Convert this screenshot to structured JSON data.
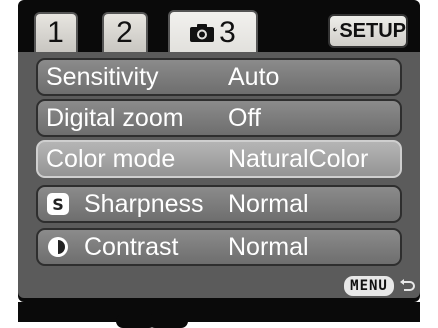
{
  "tabs": [
    {
      "label": "1",
      "active": false
    },
    {
      "label": "2",
      "active": false
    },
    {
      "label": "3",
      "icon": "camera-icon",
      "active": true
    }
  ],
  "setup": {
    "label": "SETUP",
    "icon": "wrench-icon"
  },
  "menu_items": [
    {
      "label": "Sensitivity",
      "value": "Auto",
      "selected": false
    },
    {
      "label": "Digital zoom",
      "value": "Off",
      "selected": false
    },
    {
      "label": "Color mode",
      "value": "NaturalColor",
      "selected": true
    },
    {
      "label": "Sharpness",
      "value": "Normal",
      "icon": "sharpness-icon",
      "selected": false
    },
    {
      "label": "Contrast",
      "value": "Normal",
      "icon": "contrast-icon",
      "selected": false
    }
  ],
  "footer": {
    "menu_label": "MENU",
    "return_icon": "return-icon"
  },
  "colors": {
    "panel": "#5b5b5b",
    "row": "#7c7c7c",
    "row_selected": "#a5a5a5",
    "tab": "#e1e0dc"
  }
}
